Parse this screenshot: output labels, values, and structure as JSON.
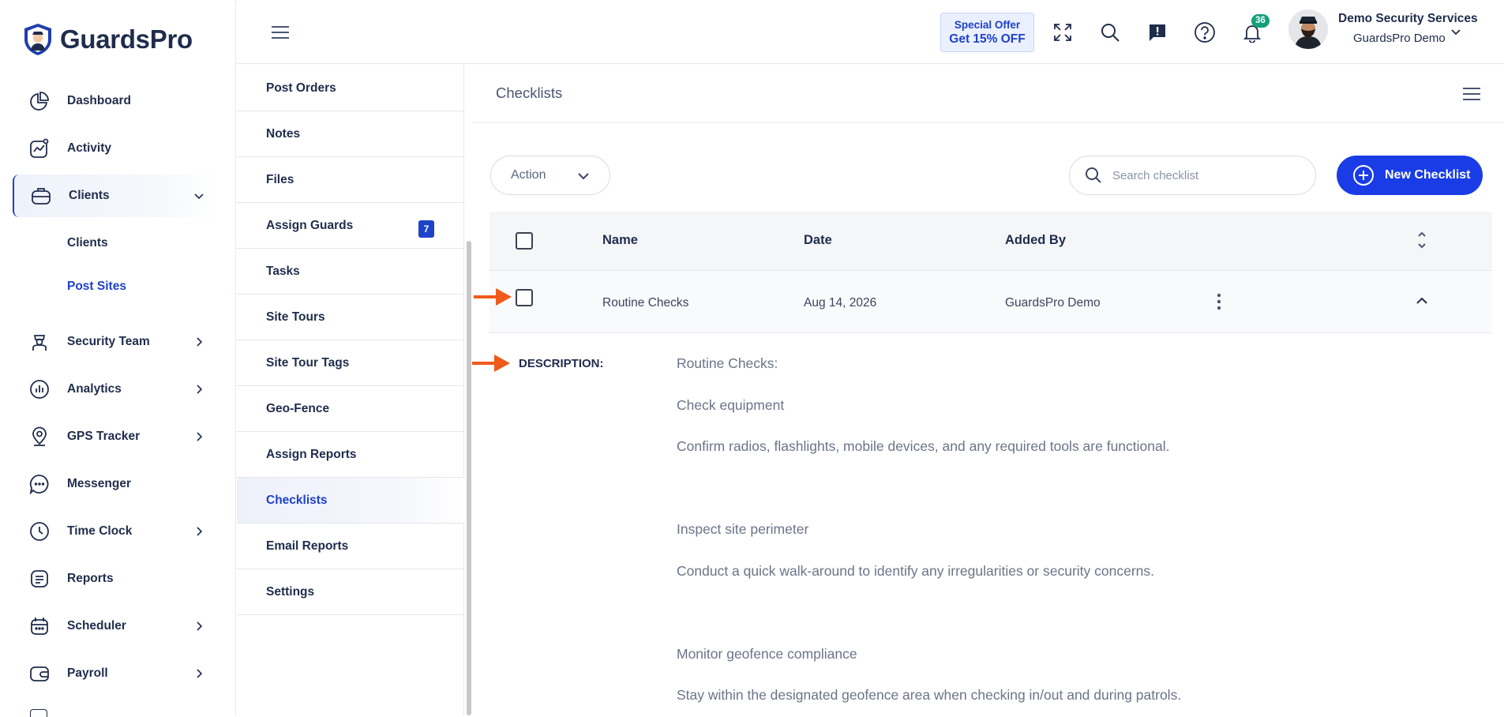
{
  "brand": {
    "name": "GuardsPro"
  },
  "sidebar": {
    "items": [
      {
        "label": "Dashboard",
        "icon": "pie-chart-icon",
        "has_children": false
      },
      {
        "label": "Activity",
        "icon": "activity-chart-icon",
        "has_children": false
      },
      {
        "label": "Clients",
        "icon": "briefcase-icon",
        "has_children": true,
        "expanded": true
      },
      {
        "label": "Security Team",
        "icon": "guard-icon",
        "has_children": true
      },
      {
        "label": "Analytics",
        "icon": "analytics-icon",
        "has_children": true
      },
      {
        "label": "GPS Tracker",
        "icon": "map-pin-icon",
        "has_children": true
      },
      {
        "label": "Messenger",
        "icon": "chat-icon",
        "has_children": false
      },
      {
        "label": "Time Clock",
        "icon": "clock-icon",
        "has_children": true
      },
      {
        "label": "Reports",
        "icon": "report-icon",
        "has_children": false
      },
      {
        "label": "Scheduler",
        "icon": "calendar-icon",
        "has_children": true
      },
      {
        "label": "Payroll",
        "icon": "wallet-icon",
        "has_children": true
      }
    ],
    "clients_sub": [
      {
        "label": "Clients",
        "active": false
      },
      {
        "label": "Post Sites",
        "active": true
      }
    ]
  },
  "header": {
    "offer_title": "Special Offer",
    "offer_text": "Get 15% OFF",
    "notification_count": "36",
    "user_name": "Demo Security Services",
    "user_org": "GuardsPro Demo"
  },
  "submenu": {
    "items": [
      {
        "label": "Post Orders"
      },
      {
        "label": "Notes"
      },
      {
        "label": "Files"
      },
      {
        "label": "Assign Guards",
        "badge": "7"
      },
      {
        "label": "Tasks"
      },
      {
        "label": "Site Tours"
      },
      {
        "label": "Site Tour Tags"
      },
      {
        "label": "Geo-Fence"
      },
      {
        "label": "Assign Reports"
      },
      {
        "label": "Checklists",
        "active": true
      },
      {
        "label": "Email Reports"
      },
      {
        "label": "Settings"
      }
    ]
  },
  "main": {
    "title": "Checklists",
    "action_label": "Action",
    "search_placeholder": "Search checklist",
    "new_button_label": "New Checklist",
    "table": {
      "columns": [
        "Name",
        "Date",
        "Added By"
      ],
      "rows": [
        {
          "name": "Routine Checks",
          "date": "Aug 14, 2026",
          "added_by": "GuardsPro Demo"
        }
      ]
    },
    "description_label": "DESCRIPTION:",
    "description_lines": [
      "Routine Checks:",
      "Check equipment",
      "Confirm radios, flashlights, mobile devices, and any required tools are functional.",
      "Inspect site perimeter",
      "Conduct a quick walk-around to identify any irregularities or security concerns.",
      "Monitor geofence compliance",
      "Stay within the designated geofence area when checking in/out and during patrols."
    ]
  },
  "colors": {
    "accent": "#1e42c8",
    "button": "#1a3ce6",
    "annotation_arrow": "#f05a1a",
    "badge_green": "#169f7d"
  }
}
